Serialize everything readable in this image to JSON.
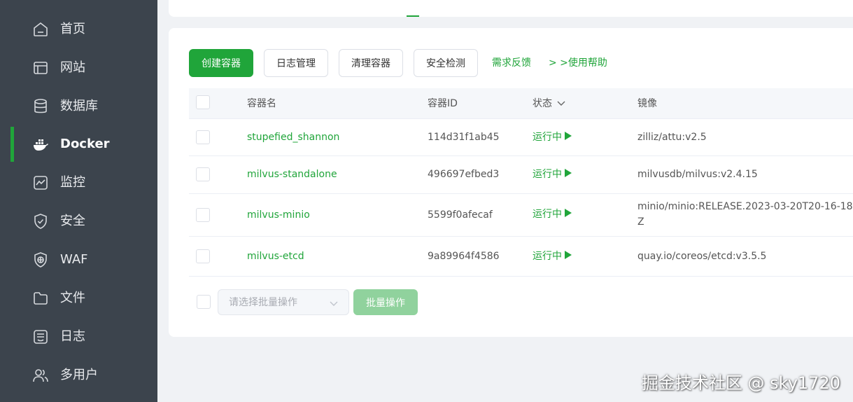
{
  "sidebar": {
    "items": [
      {
        "label": "首页",
        "icon": "home-icon"
      },
      {
        "label": "网站",
        "icon": "browser-window-icon"
      },
      {
        "label": "数据库",
        "icon": "database-icon"
      },
      {
        "label": "Docker",
        "icon": "docker-whale-icon",
        "active": true
      },
      {
        "label": "监控",
        "icon": "monitor-chart-icon"
      },
      {
        "label": "安全",
        "icon": "shield-check-icon"
      },
      {
        "label": "WAF",
        "icon": "waf-shield-icon"
      },
      {
        "label": "文件",
        "icon": "folder-icon"
      },
      {
        "label": "日志",
        "icon": "log-icon"
      },
      {
        "label": "多用户",
        "icon": "users-icon"
      }
    ]
  },
  "toolbar": {
    "create_label": "创建容器",
    "logs_label": "日志管理",
    "clean_label": "清理容器",
    "security_label": "安全检测",
    "feedback_label": "需求反馈",
    "help_label": "> >使用帮助"
  },
  "table": {
    "headers": {
      "name": "容器名",
      "id": "容器ID",
      "status": "状态",
      "image": "镜像"
    },
    "rows": [
      {
        "name": "stupefied_shannon",
        "id": "114d31f1ab45",
        "status": "运行中",
        "image": "zilliz/attu:v2.5"
      },
      {
        "name": "milvus-standalone",
        "id": "496697efbed3",
        "status": "运行中",
        "image": "milvusdb/milvus:v2.4.15"
      },
      {
        "name": "milvus-minio",
        "id": "5599f0afecaf",
        "status": "运行中",
        "image": "minio/minio:RELEASE.2023-03-20T20-16-18Z"
      },
      {
        "name": "milvus-etcd",
        "id": "9a89964f4586",
        "status": "运行中",
        "image": "quay.io/coreos/etcd:v3.5.5"
      }
    ]
  },
  "batch": {
    "placeholder": "请选择批量操作",
    "button_label": "批量操作"
  },
  "watermark": "掘金技术社区 @ sky1720",
  "colors": {
    "accent": "#20a53a",
    "sidebar_bg": "#3c444d",
    "disabled_accent": "#90d29d"
  }
}
